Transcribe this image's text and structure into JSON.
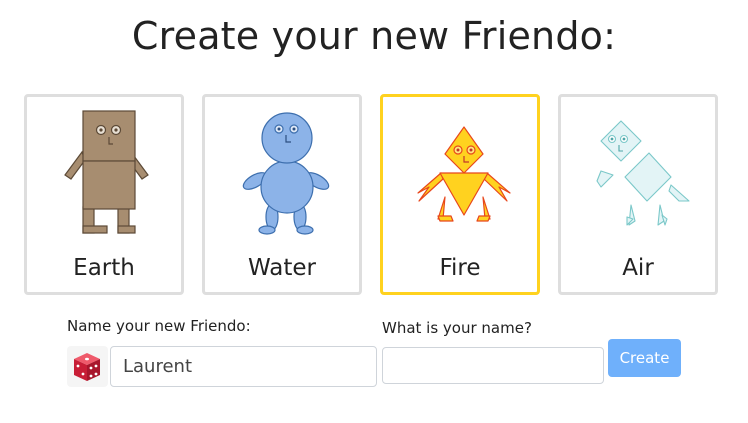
{
  "header": {
    "title": "Create your new Friendo:"
  },
  "cards": [
    {
      "label": "Earth",
      "selected": false
    },
    {
      "label": "Water",
      "selected": false
    },
    {
      "label": "Fire",
      "selected": true
    },
    {
      "label": "Air",
      "selected": false
    }
  ],
  "form": {
    "friendo_name_label": "Name your new Friendo:",
    "friendo_name_value": "Laurent",
    "your_name_label": "What is your name?",
    "your_name_value": "",
    "your_name_placeholder": "",
    "create_label": "Create"
  },
  "icons": {
    "randomize": "dice-icon"
  },
  "colors": {
    "selected_border": "#ffd21f",
    "card_border": "#dedede",
    "button": "#6fb0fb",
    "earth": "#a78d70",
    "water": "#8cb3e8",
    "fire": "#ffd21f",
    "air": "#dff2f5",
    "dice": "#d7263d"
  }
}
